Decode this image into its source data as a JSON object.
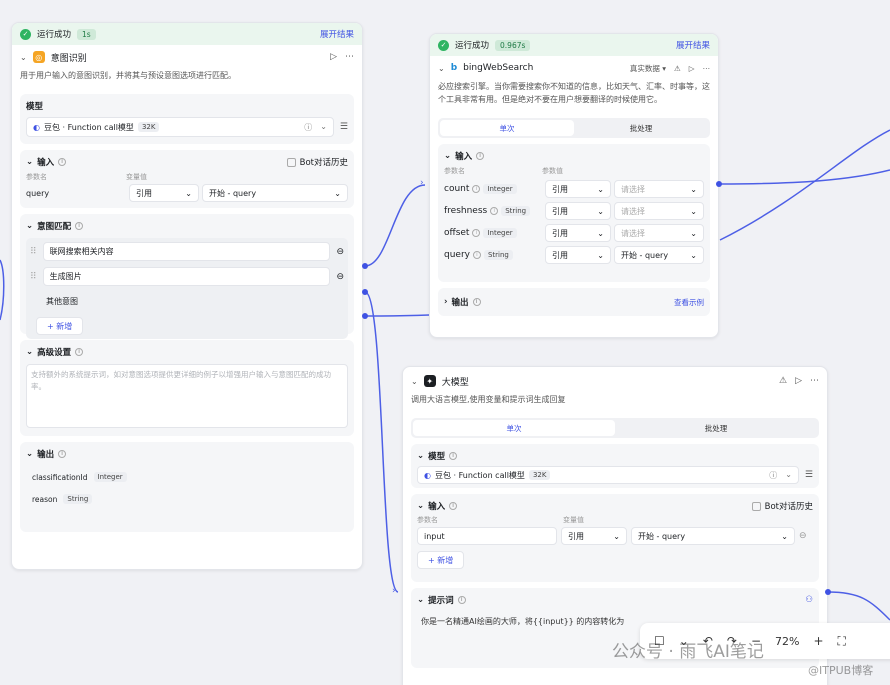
{
  "node_intent": {
    "status": "运行成功",
    "duration": "1s",
    "expand": "展开结果",
    "title": "意图识别",
    "description": "用于用户输入的意图识别，并将其与预设意图选项进行匹配。",
    "model_label": "模型",
    "model_name": "豆包 · Function call模型",
    "model_tag": "32K",
    "input_label": "输入",
    "bot_history": "Bot对话历史",
    "param_name_col": "参数名",
    "var_value_col": "变量值",
    "param_name": "query",
    "ref": "引用",
    "ref_value": "开始 - query",
    "match_label": "意图匹配",
    "intents": [
      "联网搜索相关内容",
      "生成图片"
    ],
    "other_intent": "其他意图",
    "add_label": "+ 新增",
    "advanced_label": "高级设置",
    "advanced_placeholder": "支持额外的系统提示词，如对意图选项提供更详细的例子以增强用户输入与意图匹配的成功率。",
    "output_label": "输出",
    "outputs": [
      {
        "name": "classificationId",
        "type": "Integer"
      },
      {
        "name": "reason",
        "type": "String"
      }
    ]
  },
  "node_bing": {
    "status": "运行成功",
    "duration": "0.967s",
    "expand": "展开结果",
    "title": "bingWebSearch",
    "realtime": "真实数据",
    "description": "必应搜索引擎。当你需要搜索你不知道的信息，比如天气、汇率、时事等，这个工具非常有用。但是绝对不要在用户想要翻译的时候使用它。",
    "tab_single": "单次",
    "tab_batch": "批处理",
    "input_label": "输入",
    "param_name_col": "参数名",
    "param_value_col": "参数值",
    "params": [
      {
        "name": "count",
        "type": "Integer",
        "ref": "引用",
        "value": "请选择"
      },
      {
        "name": "freshness",
        "type": "String",
        "ref": "引用",
        "value": "请选择"
      },
      {
        "name": "offset",
        "type": "Integer",
        "ref": "引用",
        "value": "请选择"
      },
      {
        "name": "query",
        "type": "String",
        "ref": "引用",
        "value": "开始 - query"
      }
    ],
    "output_label": "输出",
    "view_example": "查看示例"
  },
  "node_llm": {
    "title": "大模型",
    "description": "调用大语言模型,使用变量和提示词生成回复",
    "tab_single": "单次",
    "tab_batch": "批处理",
    "model_label": "模型",
    "model_name": "豆包 · Function call模型",
    "model_tag": "32K",
    "input_label": "输入",
    "bot_history": "Bot对话历史",
    "param_name_col": "参数名",
    "var_value_col": "变量值",
    "param_name": "input",
    "ref": "引用",
    "ref_value": "开始 - query",
    "add_label": "+ 新增",
    "prompt_label": "提示词",
    "prompt_text": "你是一名精通AI绘画的大师，将{{input}} 的内容转化为"
  },
  "toolbar": {
    "zoom": "72%"
  },
  "watermark": {
    "main": "公众号 · 雨飞AI笔记",
    "sub": "@ITPUB博客"
  },
  "colors": {
    "accent": "#3f52e3",
    "success": "#2fb462",
    "canvas": "#f0f1f5"
  }
}
